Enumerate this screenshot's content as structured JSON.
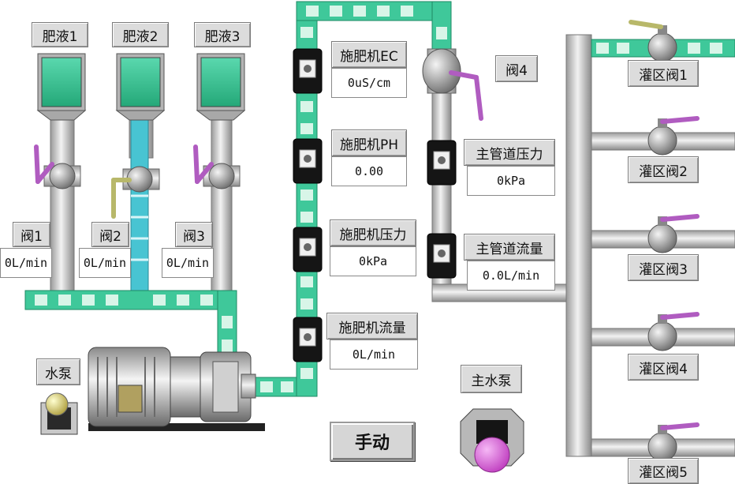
{
  "colors": {
    "pipe_green": "#3fc89a",
    "pipe_light": "#d8f5e8",
    "pipe_gray": "#c8c8c8",
    "tank_green": "#36c896",
    "cyan": "#42c0d0",
    "valve_handle": "#b05cc0",
    "valve_handle_alt": "#b8b86a"
  },
  "tanks": [
    {
      "label": "肥液1"
    },
    {
      "label": "肥液2"
    },
    {
      "label": "肥液3"
    }
  ],
  "tank_valves": [
    {
      "label": "阀1",
      "flow": "0L/min"
    },
    {
      "label": "阀2",
      "flow": "0L/min"
    },
    {
      "label": "阀3",
      "flow": "0L/min"
    }
  ],
  "fertilizer_readouts": [
    {
      "label": "施肥机EC",
      "value": "0uS/cm"
    },
    {
      "label": "施肥机PH",
      "value": "0.00"
    },
    {
      "label": "施肥机压力",
      "value": "0kPa"
    },
    {
      "label": "施肥机流量",
      "value": "0L/min"
    }
  ],
  "valve4": {
    "label": "阀4"
  },
  "main_readouts": [
    {
      "label": "主管道压力",
      "value": "0kPa"
    },
    {
      "label": "主管道流量",
      "value": "0.0L/min"
    }
  ],
  "zone_valves": [
    {
      "label": "灌区阀1"
    },
    {
      "label": "灌区阀2"
    },
    {
      "label": "灌区阀3"
    },
    {
      "label": "灌区阀4"
    },
    {
      "label": "灌区阀5"
    }
  ],
  "water_pump": {
    "label": "水泵"
  },
  "main_pump": {
    "label": "主水泵"
  },
  "mode_button": {
    "label": "手动"
  }
}
